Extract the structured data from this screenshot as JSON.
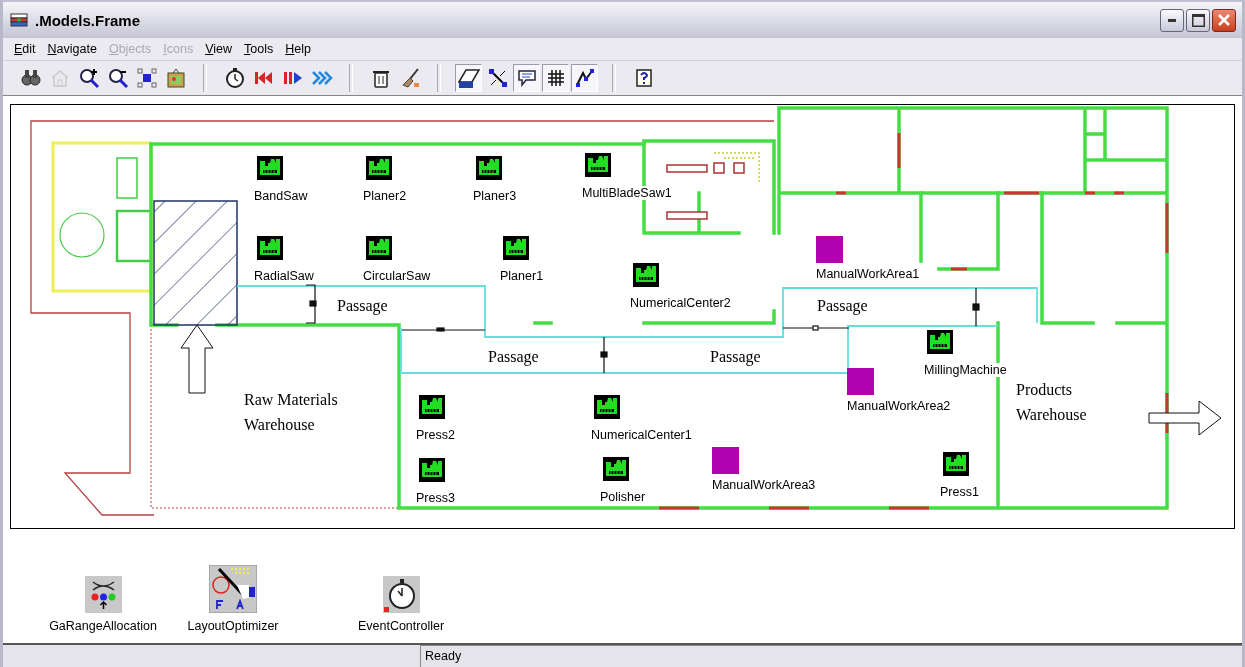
{
  "window": {
    "title": ".Models.Frame"
  },
  "menu": [
    {
      "label": "Edit",
      "disabled": false
    },
    {
      "label": "Navigate",
      "disabled": false
    },
    {
      "label": "Objects",
      "disabled": true
    },
    {
      "label": "Icons",
      "disabled": true
    },
    {
      "label": "View",
      "disabled": false
    },
    {
      "label": "Tools",
      "disabled": false
    },
    {
      "label": "Help",
      "disabled": false
    }
  ],
  "toolbar": {
    "groups": [
      {
        "buttons": [
          {
            "disabled": false
          },
          {
            "disabled": true
          },
          {
            "disabled": false
          },
          {
            "disabled": false
          },
          {
            "disabled": false
          },
          {
            "disabled": false
          }
        ]
      },
      {
        "buttons": [
          {
            "disabled": false
          },
          {
            "disabled": false
          },
          {
            "disabled": false
          },
          {
            "disabled": false
          }
        ]
      },
      {
        "buttons": [
          {
            "disabled": false
          },
          {
            "disabled": false
          }
        ]
      },
      {
        "buttons": [
          {
            "disabled": false,
            "pressed": true
          },
          {
            "disabled": false,
            "pressed": false
          },
          {
            "disabled": false,
            "pressed": true
          },
          {
            "disabled": false,
            "pressed": true
          },
          {
            "disabled": false,
            "pressed": true
          }
        ]
      },
      {
        "buttons": [
          {
            "disabled": false
          }
        ]
      }
    ]
  },
  "floor_plan": {
    "machines": [
      {
        "label": "BandSaw",
        "kind": "machine"
      },
      {
        "label": "Planer2",
        "kind": "machine"
      },
      {
        "label": "Planer3",
        "kind": "machine"
      },
      {
        "label": "MultiBladeSaw1",
        "kind": "machine"
      },
      {
        "label": "RadialSaw",
        "kind": "machine"
      },
      {
        "label": "CircularSaw",
        "kind": "machine"
      },
      {
        "label": "Planer1",
        "kind": "machine"
      },
      {
        "label": "NumericalCenter2",
        "kind": "machine"
      },
      {
        "label": "ManualWorkArea1",
        "kind": "manual_area"
      },
      {
        "label": "MillingMachine",
        "kind": "machine"
      },
      {
        "label": "ManualWorkArea2",
        "kind": "manual_area"
      },
      {
        "label": "Press2",
        "kind": "machine"
      },
      {
        "label": "NumericalCenter1",
        "kind": "machine"
      },
      {
        "label": "Press3",
        "kind": "machine"
      },
      {
        "label": "Polisher",
        "kind": "machine"
      },
      {
        "label": "ManualWorkArea3",
        "kind": "manual_area"
      },
      {
        "label": "Press1",
        "kind": "machine"
      }
    ],
    "areas": [
      {
        "lines": [
          "Passage"
        ]
      },
      {
        "lines": [
          "Passage"
        ]
      },
      {
        "lines": [
          "Passage"
        ]
      },
      {
        "lines": [
          "Passage"
        ]
      },
      {
        "lines": [
          "Raw Materials",
          "Warehouse"
        ]
      },
      {
        "lines": [
          "Products",
          "Warehouse"
        ]
      }
    ]
  },
  "components": [
    {
      "label": "GaRangeAllocation"
    },
    {
      "label": "LayoutOptimizer"
    },
    {
      "label": "EventController"
    }
  ],
  "status_bar": {
    "text": "Ready"
  }
}
